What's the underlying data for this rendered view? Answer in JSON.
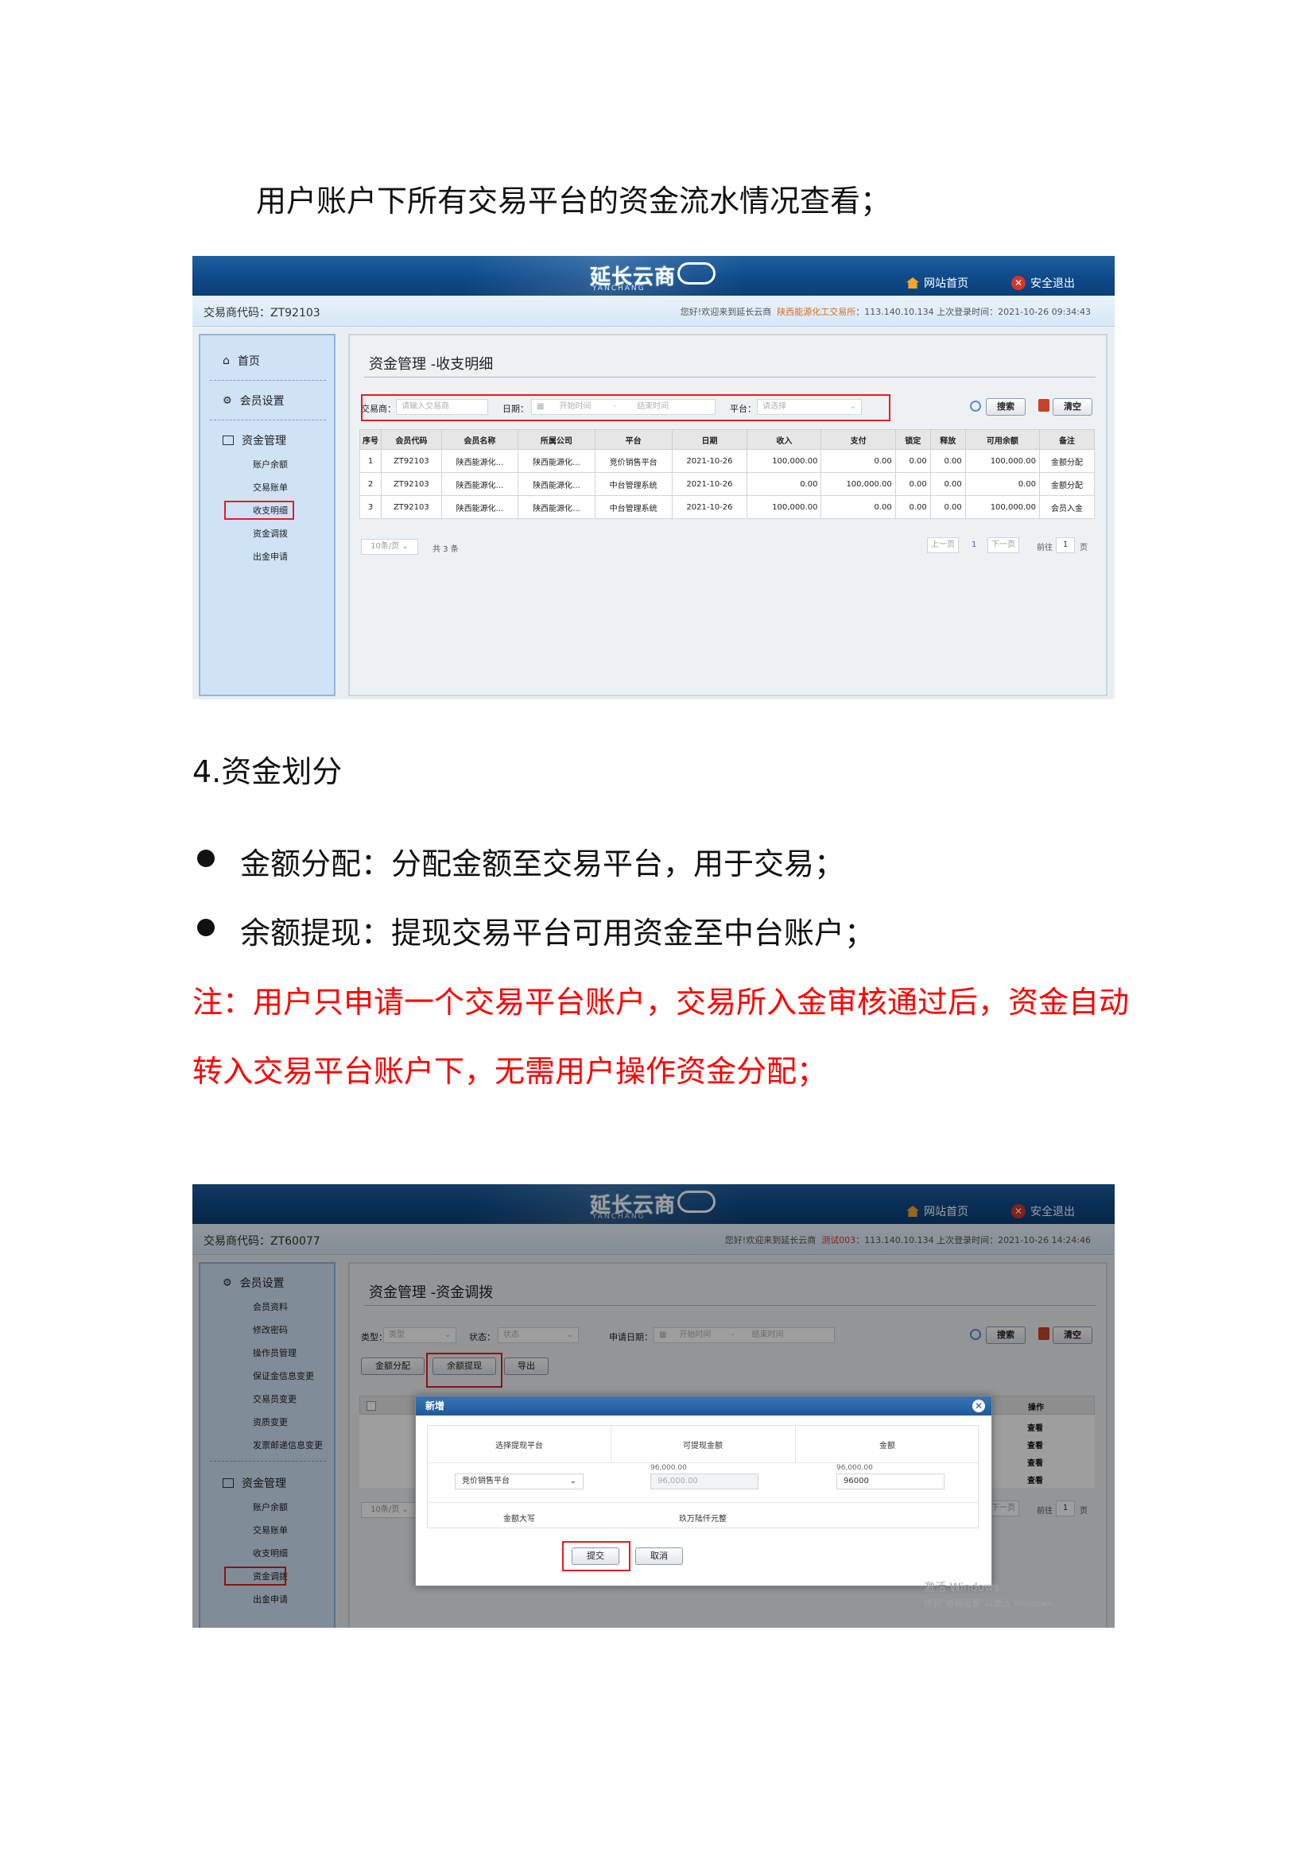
{
  "doc": {
    "intro": "用户账户下所有交易平台的资金流水情况查看；",
    "section_title": "4.资金划分",
    "bullets": [
      "金额分配：分配金额至交易平台，用于交易；",
      "余额提现：提现交易平台可用资金至中台账户；"
    ],
    "note_line1": "注：用户只申请一个交易平台账户，交易所入金审核通过后，资金自动",
    "note_line2": "转入交易平台账户下，无需用户操作资金分配；"
  },
  "shot1": {
    "logo": "延长云商",
    "logo_sub": "YANCHANG",
    "home_link": "网站首页",
    "exit_link": "安全退出",
    "trader_code": "交易商代码：ZT92103",
    "welcome": "您好!欢迎来到延长云商",
    "org": "陕西能源化工交易所",
    "ip_login": "113.140.10.134  上次登录时间：2021-10-26 09:34:43",
    "sidebar": {
      "home": "首页",
      "member_settings": "会员设置",
      "fund_mgmt": "资金管理",
      "items": [
        "账户余额",
        "交易账单",
        "收支明细",
        "资金调拨",
        "出金申请"
      ]
    },
    "page_title": "资金管理 -收支明细",
    "filters": {
      "trader_label": "交易商：",
      "trader_placeholder": "请输入交易商",
      "date_label": "日期：",
      "start_placeholder": "开始时间",
      "dash": "-",
      "end_placeholder": "结束时间",
      "platform_label": "平台：",
      "platform_placeholder": "请选择"
    },
    "search_btn": "搜索",
    "clear_btn": "清空",
    "table": {
      "headers": [
        "序号",
        "会员代码",
        "会员名称",
        "所属公司",
        "平台",
        "日期",
        "收入",
        "支付",
        "锁定",
        "释放",
        "可用余额",
        "备注"
      ],
      "rows": [
        [
          "1",
          "ZT92103",
          "陕西能源化...",
          "陕西能源化...",
          "竞价销售平台",
          "2021-10-26",
          "100,000.00",
          "0.00",
          "0.00",
          "0.00",
          "100,000.00",
          "金额分配"
        ],
        [
          "2",
          "ZT92103",
          "陕西能源化...",
          "陕西能源化...",
          "中台管理系统",
          "2021-10-26",
          "0.00",
          "100,000.00",
          "0.00",
          "0.00",
          "0.00",
          "金额分配"
        ],
        [
          "3",
          "ZT92103",
          "陕西能源化...",
          "陕西能源化...",
          "中台管理系统",
          "2021-10-26",
          "100,000.00",
          "0.00",
          "0.00",
          "0.00",
          "100,000.00",
          "会员入金"
        ]
      ]
    },
    "pager": {
      "page_size": "10条/页",
      "total": "共 3 条",
      "prev": "上一页",
      "page": "1",
      "next": "下一页",
      "goto": "前往",
      "goto_value": "1",
      "page_suffix": "页"
    }
  },
  "shot2": {
    "logo": "延长云商",
    "logo_sub": "YANCHANG",
    "home_link": "网站首页",
    "exit_link": "安全退出",
    "trader_code": "交易商代码：ZT60077",
    "welcome": "您好!欢迎来到延长云商",
    "org": "测试003",
    "ip_login": "113.140.10.134  上次登录时间：2021-10-26 14:24:46",
    "sidebar": {
      "member_settings": "会员设置",
      "member_items": [
        "会员资料",
        "修改密码",
        "操作员管理",
        "保证金信息变更",
        "交易员变更",
        "资质变更",
        "发票邮递信息变更"
      ],
      "fund_mgmt": "资金管理",
      "fund_items": [
        "账户余额",
        "交易账单",
        "收支明细",
        "资金调拨",
        "出金申请"
      ]
    },
    "page_title": "资金管理 -资金调拨",
    "filters": {
      "type_label": "类型：",
      "type_placeholder": "类型",
      "status_label": "状态：",
      "status_placeholder": "状态",
      "date_label": "申请日期：",
      "start_placeholder": "开始时间",
      "dash": "-",
      "end_placeholder": "结束时间"
    },
    "search_btn": "搜索",
    "clear_btn": "清空",
    "action_btns": [
      "金额分配",
      "余额提现",
      "导出"
    ],
    "table_op_header": "操作",
    "table_ops": [
      "查看",
      "查看",
      "查看",
      "查看"
    ],
    "pager": {
      "page_size": "10条/页",
      "next": "下一页",
      "goto": "前往",
      "goto_value": "1",
      "page_suffix": "页"
    },
    "modal": {
      "title": "新增",
      "col1": "选择提现平台",
      "col2": "可提现金额",
      "col3": "金额",
      "avail_small": "96,000.00",
      "avail_input": "96,000.00",
      "amount_small": "96,000.00",
      "platform_value": "竞价销售平台",
      "amount_value": "96000",
      "capital_label": "金额大写",
      "capital_value": "玖万陆仟元整",
      "submit": "提交",
      "cancel": "取消"
    },
    "watermark_line1": "激活 Windows",
    "watermark_line2": "转到\"电脑设置\"以激活 Windows。"
  }
}
